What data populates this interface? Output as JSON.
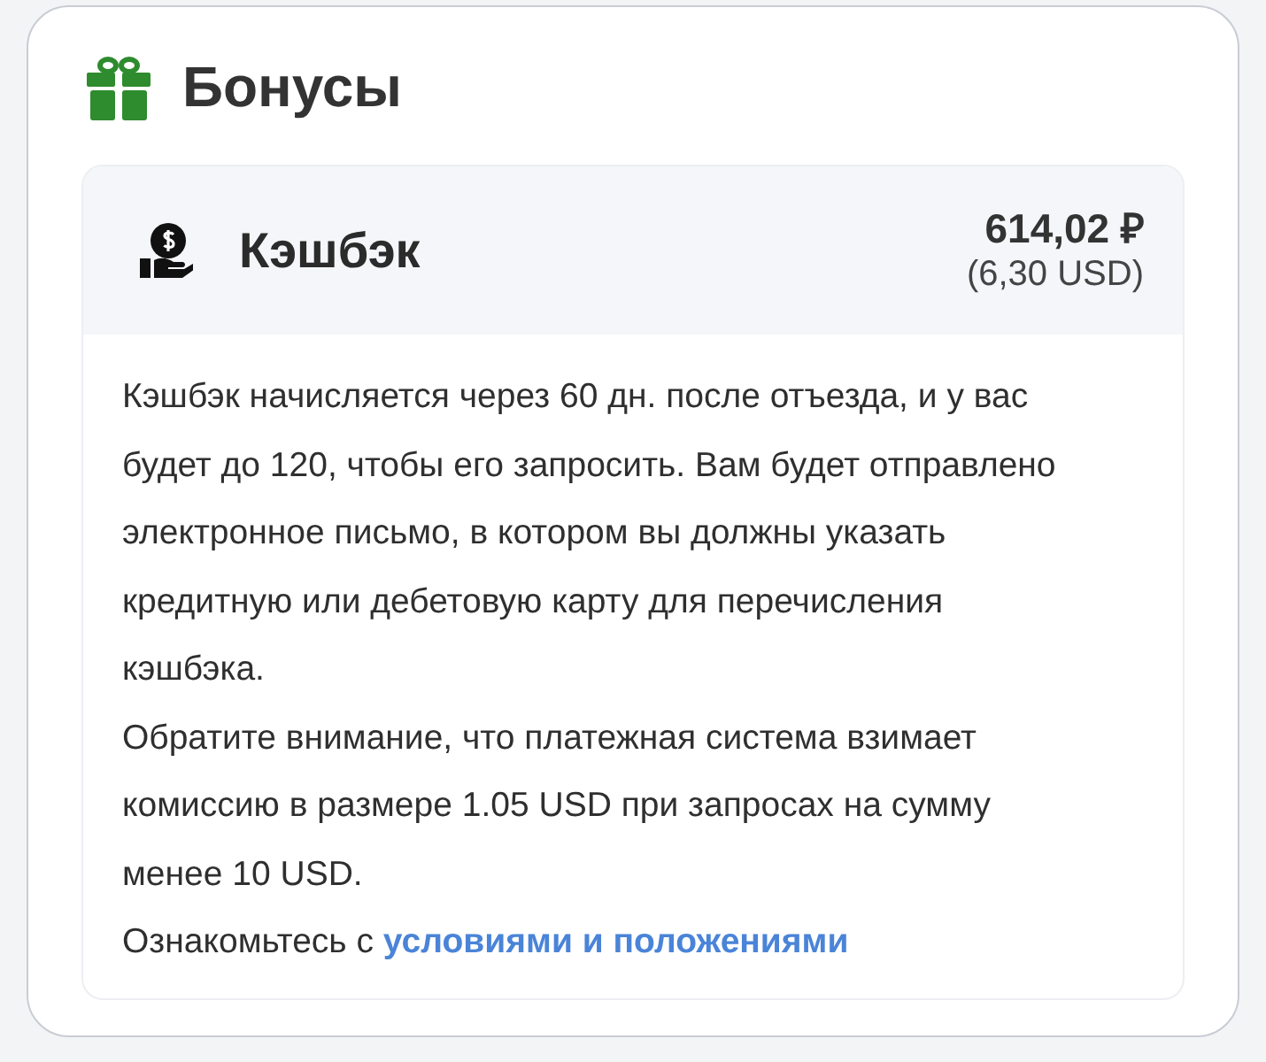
{
  "section": {
    "title": "Бонусы"
  },
  "cashback": {
    "title": "Кэшбэк",
    "amount": "614,02 ₽",
    "converted": "(6,30 USD)",
    "paragraphs": [
      {
        "text": "Кэшбэк начисляется через 60 дн. после отъезда, и у вас будет до 120, чтобы его запросить. Вам будет отправлено электронное письмо, в котором вы должны указать кредитную или дебетовую карту для перечисления кэшбэка."
      },
      {
        "text": "Обратите внимание, что платежная система взимает комиссию в размере 1.05 USD при запросах на сумму менее 10 USD."
      },
      {
        "text": "Ознакомьтесь с",
        "link": "условиями и положениями"
      }
    ]
  }
}
